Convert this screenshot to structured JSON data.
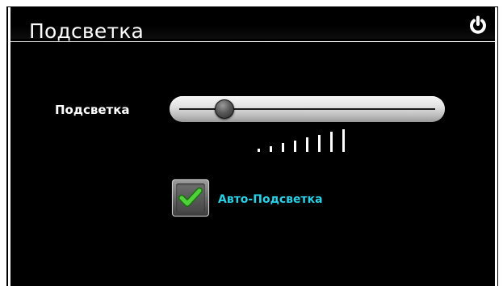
{
  "header": {
    "title": "Подсветка",
    "power_icon": "power-icon"
  },
  "backlight": {
    "label": "Подсветка",
    "level": 0.15,
    "level_bars_count": 8
  },
  "auto_backlight": {
    "label": "Авто-Подсветка",
    "checked": true,
    "check_color": "#3fbf2a"
  },
  "colors": {
    "background": "#000000",
    "label_accent": "#2ad0e6",
    "text": "#ffffff"
  }
}
